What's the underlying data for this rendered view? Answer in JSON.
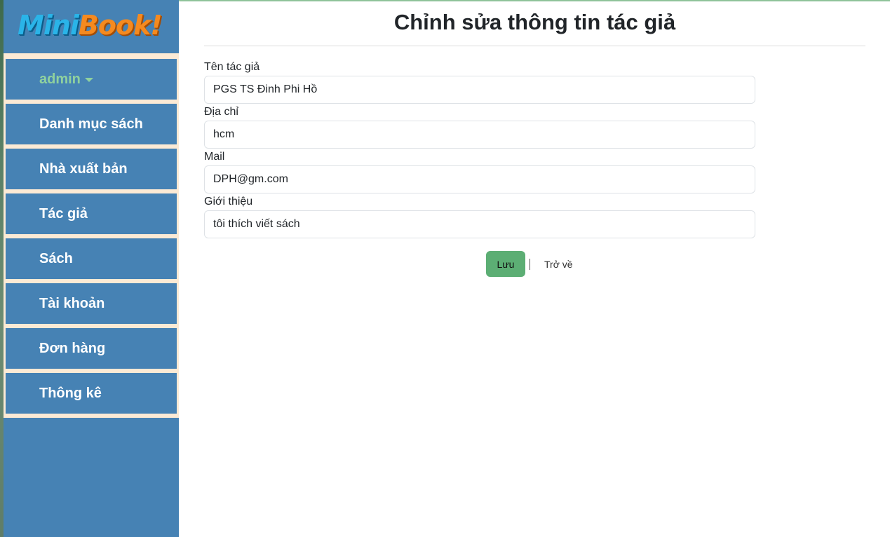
{
  "sidebar": {
    "logo": {
      "part1": "Mini",
      "part2": "Book!"
    },
    "user": {
      "label": "admin"
    },
    "items": [
      {
        "label": "Danh mục sách"
      },
      {
        "label": "Nhà xuất bản"
      },
      {
        "label": "Tác giả"
      },
      {
        "label": "Sách"
      },
      {
        "label": "Tài khoản"
      },
      {
        "label": "Đơn hàng"
      },
      {
        "label": "Thông kê"
      }
    ]
  },
  "main": {
    "title": "Chỉnh sửa thông tin tác giả",
    "form": {
      "name": {
        "label": "Tên tác giả",
        "value": "PGS TS Đinh Phi Hồ"
      },
      "address": {
        "label": "Địa chỉ",
        "value": "hcm"
      },
      "mail": {
        "label": "Mail",
        "value": "DPH@gm.com"
      },
      "intro": {
        "label": "Giới thiệu",
        "value": "tôi thích viết sách"
      }
    },
    "actions": {
      "save_label": "Lưu",
      "back_label": "Trở về"
    }
  },
  "colors": {
    "sidebar_bg": "#4682b4",
    "menu_gap": "#fbead5",
    "admin_text": "#8fd19e",
    "save_button": "#5cae74"
  },
  "icons": {
    "user_menu": "caret-down-icon"
  }
}
